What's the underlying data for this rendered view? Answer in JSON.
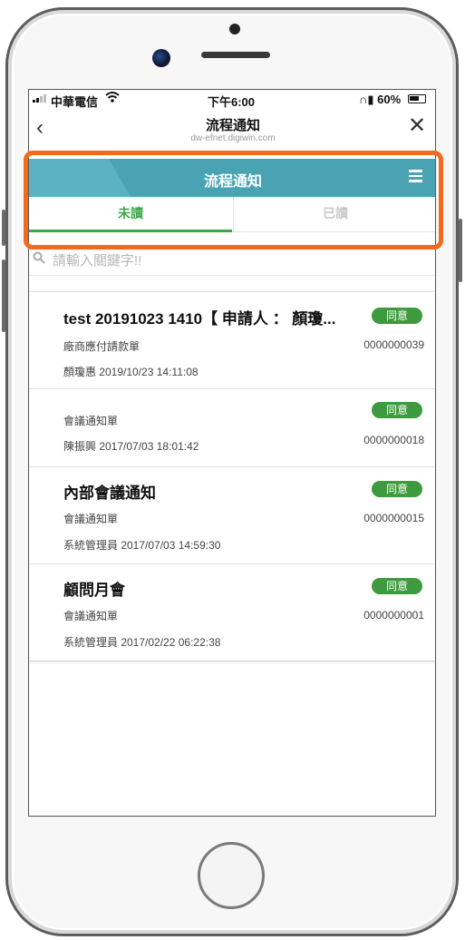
{
  "status_bar": {
    "carrier": "中華電信",
    "time": "下午6:00",
    "battery": "60%"
  },
  "nav": {
    "title": "流程通知",
    "subtitle": "dw-efnet.digiwin.com"
  },
  "header": {
    "title": "流程通知"
  },
  "tabs": [
    {
      "label": "未讀",
      "active": true
    },
    {
      "label": "已讀",
      "active": false
    }
  ],
  "search": {
    "placeholder": "請輸入關鍵字!!"
  },
  "items": [
    {
      "title": "test 20191023 1410【 申請人 ： 顏瓊...",
      "type": "廠商應付請款單",
      "meta": "顏瓊惠 2019/10/23 14:11:08",
      "number": "0000000039",
      "badge": "同意"
    },
    {
      "title": "",
      "type": "會議通知單",
      "meta": "陳振興 2017/07/03 18:01:42",
      "number": "0000000018",
      "badge": "同意"
    },
    {
      "title": "內部會議通知",
      "type": "會議通知單",
      "meta": "系統管理員 2017/07/03 14:59:30",
      "number": "0000000015",
      "badge": "同意"
    },
    {
      "title": "顧問月會",
      "type": "會議通知單",
      "meta": "系統管理員 2017/02/22 06:22:38",
      "number": "0000000001",
      "badge": "同意"
    }
  ],
  "colors": {
    "header": "#4aa3b3",
    "accent_green": "#3da84a",
    "badge": "#3e9a3e",
    "highlight": "#f26a1b"
  }
}
